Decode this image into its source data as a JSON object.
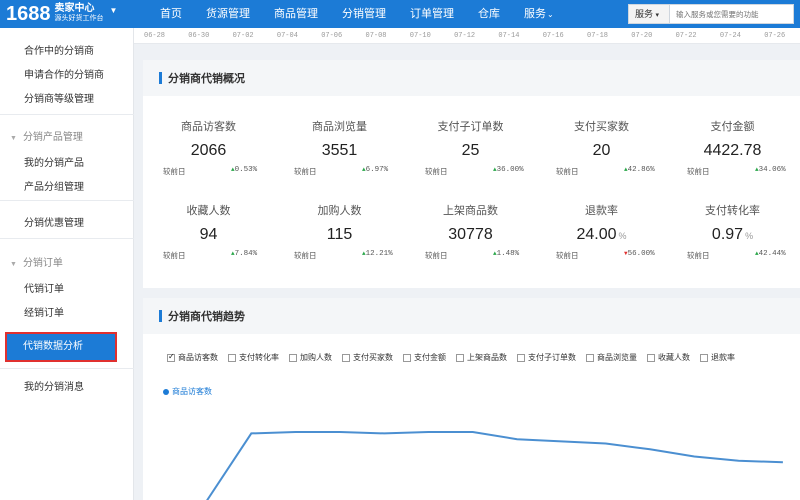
{
  "header": {
    "logo_number": "1688",
    "logo_title": "卖家中心",
    "logo_subtitle": "源头好货工作台",
    "nav": [
      "首页",
      "货源管理",
      "商品管理",
      "分销管理",
      "订单管理",
      "仓库",
      "服务"
    ],
    "search_category": "服务",
    "search_placeholder": "输入服务或您需要的功能"
  },
  "sidebar": {
    "items_top": [
      "合作中的分销商",
      "申请合作的分销商",
      "分销商等级管理"
    ],
    "group_product": "分销产品管理",
    "items_product": [
      "我的分销产品",
      "产品分组管理"
    ],
    "item_discount": "分销优惠管理",
    "group_order": "分销订单",
    "items_order": [
      "代销订单",
      "经销订单"
    ],
    "active_item": "代销数据分析",
    "item_messages": "我的分销消息"
  },
  "date_ruler": [
    "06-28",
    "06-30",
    "07-02",
    "07-04",
    "07-06",
    "07-08",
    "07-10",
    "07-12",
    "07-14",
    "07-16",
    "07-18",
    "07-20",
    "07-22",
    "07-24",
    "07-26"
  ],
  "overview": {
    "title": "分销商代销概况",
    "compare_label": "较前日",
    "metrics": [
      {
        "label": "商品访客数",
        "value": "2066",
        "unit": "",
        "dir": "up",
        "change": "0.53%"
      },
      {
        "label": "商品浏览量",
        "value": "3551",
        "unit": "",
        "dir": "up",
        "change": "6.97%"
      },
      {
        "label": "支付子订单数",
        "value": "25",
        "unit": "",
        "dir": "up",
        "change": "36.00%"
      },
      {
        "label": "支付买家数",
        "value": "20",
        "unit": "",
        "dir": "up",
        "change": "42.86%"
      },
      {
        "label": "支付金额",
        "value": "4422.78",
        "unit": "",
        "dir": "up",
        "change": "34.06%"
      },
      {
        "label": "收藏人数",
        "value": "94",
        "unit": "",
        "dir": "up",
        "change": "7.84%"
      },
      {
        "label": "加购人数",
        "value": "115",
        "unit": "",
        "dir": "up",
        "change": "12.21%"
      },
      {
        "label": "上架商品数",
        "value": "30778",
        "unit": "",
        "dir": "up",
        "change": "1.48%"
      },
      {
        "label": "退款率",
        "value": "24.00",
        "unit": "%",
        "dir": "down",
        "change": "56.00%"
      },
      {
        "label": "支付转化率",
        "value": "0.97",
        "unit": "%",
        "dir": "up",
        "change": "42.44%"
      }
    ]
  },
  "trend": {
    "title": "分销商代销趋势",
    "options": [
      {
        "label": "商品访客数",
        "checked": true
      },
      {
        "label": "支付转化率",
        "checked": false
      },
      {
        "label": "加购人数",
        "checked": false
      },
      {
        "label": "支付买家数",
        "checked": false
      },
      {
        "label": "支付金额",
        "checked": false
      },
      {
        "label": "上架商品数",
        "checked": false
      },
      {
        "label": "支付子订单数",
        "checked": false
      },
      {
        "label": "商品浏览量",
        "checked": false
      },
      {
        "label": "收藏人数",
        "checked": false
      },
      {
        "label": "退款率",
        "checked": false
      }
    ],
    "legend": "商品访客数",
    "colors": {
      "line": "#4b8fd1",
      "accent": "#1c7bd6"
    }
  },
  "chart_data": {
    "type": "line",
    "x": [
      "06-28",
      "06-30",
      "07-02",
      "07-04",
      "07-06",
      "07-08",
      "07-10",
      "07-12",
      "07-14",
      "07-16",
      "07-18",
      "07-20",
      "07-22",
      "07-24",
      "07-26"
    ],
    "series": [
      {
        "name": "商品访客数",
        "values": [
          null,
          0.05,
          0.98,
          1.0,
          1.0,
          0.98,
          1.0,
          1.0,
          0.9,
          0.87,
          0.84,
          0.76,
          0.66,
          0.6,
          0.58
        ]
      }
    ]
  }
}
